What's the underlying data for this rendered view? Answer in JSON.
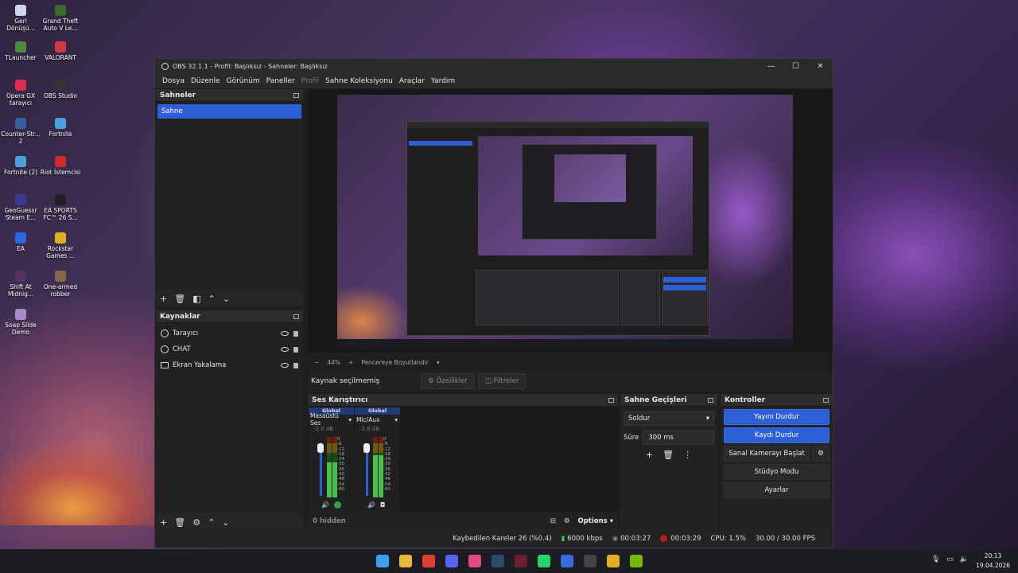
{
  "desktop_icons": [
    {
      "label": "Geri Dönüşü...",
      "color": "#c9d7e8"
    },
    {
      "label": "Grand Theft Auto V Le...",
      "color": "#3a6b2a"
    },
    {
      "label": "TLauncher",
      "color": "#4a8c3a"
    },
    {
      "label": "VALORANT",
      "color": "#d23a45"
    },
    {
      "label": "Opera GX tarayıcı",
      "color": "#e02a50"
    },
    {
      "label": "OBS Studio",
      "color": "#333333"
    },
    {
      "label": "Counter-Str... 2",
      "color": "#3a5fa0"
    },
    {
      "label": "Fortnite",
      "color": "#4aa0e0"
    },
    {
      "label": "Fortnite (2)",
      "color": "#4aa0e0"
    },
    {
      "label": "Riot İstemcisi",
      "color": "#d42a2a"
    },
    {
      "label": "GeoGuessr Steam E...",
      "color": "#3a3a90"
    },
    {
      "label": "EA SPORTS FC™ 26 S...",
      "color": "#222222"
    },
    {
      "label": "EA",
      "color": "#2a6ae0"
    },
    {
      "label": "Rockstar Games ...",
      "color": "#e0b020"
    },
    {
      "label": "Shift At Midnig...",
      "color": "#553366"
    },
    {
      "label": "One-armed robber",
      "color": "#886644"
    },
    {
      "label": "Soap Slide Demo",
      "color": "#aa88cc"
    }
  ],
  "window": {
    "title": "OBS 32.1.1 - Profil: Başlıksız - Sahneler: Başlıksız",
    "minimize": "—",
    "maximize": "☐",
    "close": "✕"
  },
  "menu": [
    "Dosya",
    "Düzenle",
    "Görünüm",
    "Paneller",
    "Profil",
    "Sahne Koleksiyonu",
    "Araçlar",
    "Yardım"
  ],
  "scenes": {
    "title": "Sahneler",
    "items": [
      "Sahne"
    ]
  },
  "sources": {
    "title": "Kaynaklar",
    "items": [
      {
        "label": "Tarayıcı",
        "icon": "globe-icon"
      },
      {
        "label": "CHAT",
        "icon": "globe-icon"
      },
      {
        "label": "Ekran Yakalama",
        "icon": "monitor-icon"
      }
    ]
  },
  "preview": {
    "zoom": "44%",
    "fit_label": "Pencereye Boyutlandır"
  },
  "properties_bar": {
    "no_source": "Kaynak seçilmemiş",
    "properties": "Özellikler",
    "filters": "Filtreler"
  },
  "mixer": {
    "title": "Ses Karıştırıcı",
    "channels": [
      {
        "scope": "Global",
        "name": "Masaüstü Ses",
        "db": "-2.0 dB",
        "level": 0.58
      },
      {
        "scope": "Global",
        "name": "Mic/Aux",
        "db": "-2.8 dB",
        "level": 0.7
      }
    ],
    "scale": [
      "0",
      "-6",
      "-12",
      "-18",
      "-24",
      "-30",
      "-36",
      "-42",
      "-48",
      "-54",
      "-60"
    ],
    "hidden_label": "0 hidden",
    "options_label": "Options"
  },
  "transitions": {
    "title": "Sahne Geçişleri",
    "selected": "Soldur",
    "duration_label": "Süre",
    "duration_value": "300 ms"
  },
  "controls": {
    "title": "Kontroller",
    "buttons": [
      "Yayını Durdur",
      "Kaydı Durdur",
      "Sanal Kamerayı Başlat",
      "Stüdyo Modu",
      "Ayarlar"
    ]
  },
  "status": {
    "dropped": "Kaybedilen Kareler 26 (%0.4)",
    "bitrate": "6000 kbps",
    "stream_time": "00:03:27",
    "rec_time": "00:03:29",
    "cpu": "CPU: 1.5%",
    "fps": "30.00 / 30.00 FPS"
  },
  "taskbar": {
    "apps": [
      {
        "name": "windows-start-icon",
        "color": "#3aa0f0"
      },
      {
        "name": "file-explorer-icon",
        "color": "#e8b838"
      },
      {
        "name": "chrome-icon",
        "color": "#e04030"
      },
      {
        "name": "discord-icon",
        "color": "#5865f2"
      },
      {
        "name": "app-icon",
        "color": "#e04a80"
      },
      {
        "name": "steam-icon",
        "color": "#2a4a70"
      },
      {
        "name": "app2-icon",
        "color": "#6a2030"
      },
      {
        "name": "whatsapp-icon",
        "color": "#25d366"
      },
      {
        "name": "app3-icon",
        "color": "#3a6ae0"
      },
      {
        "name": "obs-icon",
        "color": "#444444"
      },
      {
        "name": "rockstar-icon",
        "color": "#e0b020"
      },
      {
        "name": "nvidia-icon",
        "color": "#76b900"
      }
    ],
    "time": "20:13",
    "date": "19.04.2026"
  }
}
